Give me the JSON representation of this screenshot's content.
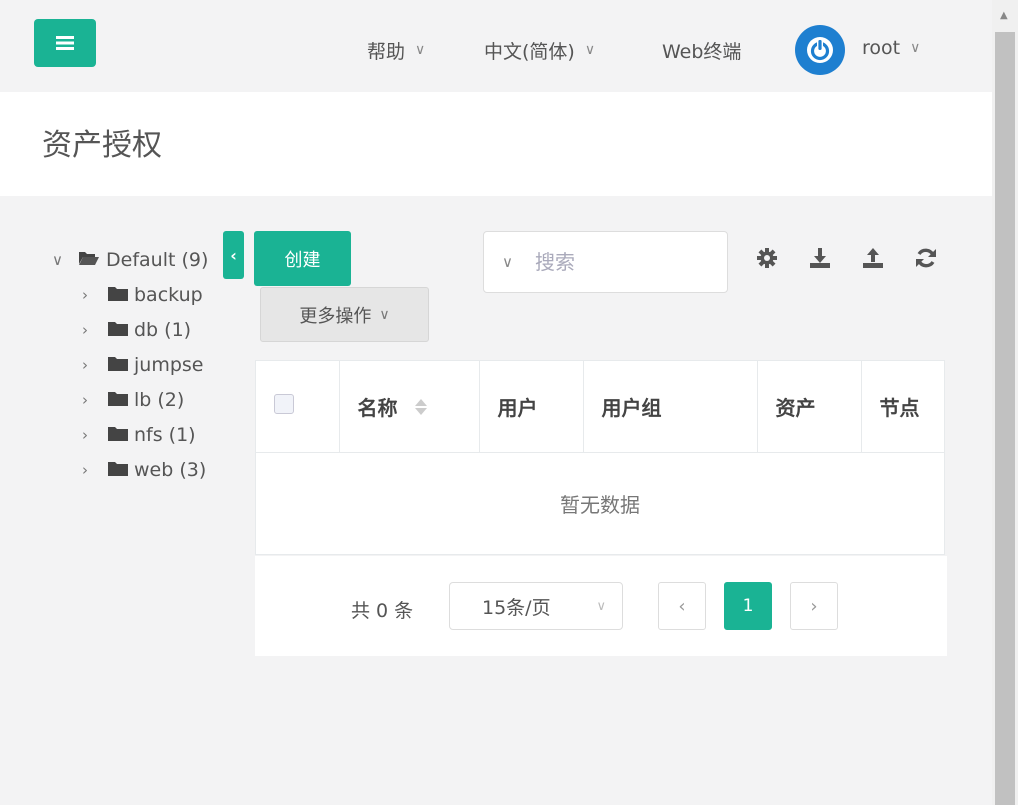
{
  "header": {
    "help_label": "帮助",
    "lang_label": "中文(简体)",
    "terminal_label": "Web终端",
    "user_label": "root"
  },
  "page": {
    "title": "资产授权"
  },
  "tree": {
    "root": {
      "label": "Default (9)"
    },
    "children": [
      {
        "label": "backup"
      },
      {
        "label": "db (1)"
      },
      {
        "label": "jumpse"
      },
      {
        "label": "lb (2)"
      },
      {
        "label": "nfs (1)"
      },
      {
        "label": "web (3)"
      }
    ]
  },
  "toolbar": {
    "create_label": "创建",
    "more_label": "更多操作",
    "search_placeholder": "搜索"
  },
  "table": {
    "columns": [
      "名称",
      "用户",
      "用户组",
      "资产",
      "节点"
    ],
    "empty_text": "暂无数据"
  },
  "pagination": {
    "total_text": "共 0 条",
    "page_size": "15条/页",
    "current_page": "1"
  },
  "colors": {
    "accent": "#1ab394",
    "avatar": "#1e7fd0"
  }
}
